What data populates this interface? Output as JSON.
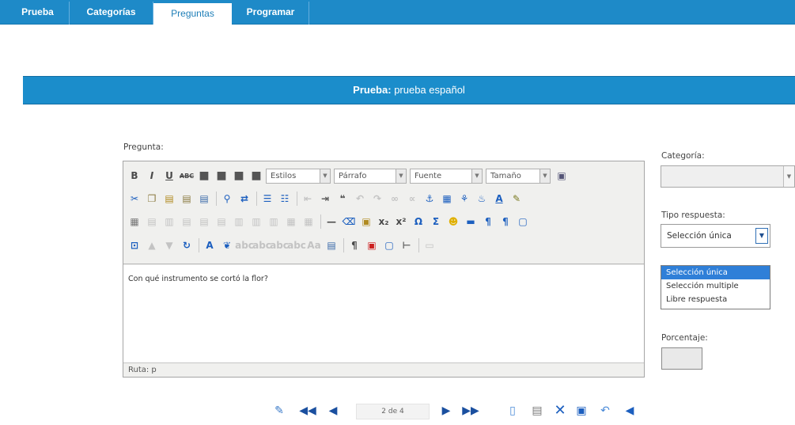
{
  "tabs": [
    {
      "label": "Prueba",
      "active": false
    },
    {
      "label": "Categorías",
      "active": false
    },
    {
      "label": "Preguntas",
      "active": true
    },
    {
      "label": "Programar",
      "active": false
    }
  ],
  "banner": {
    "prefix": "Prueba:",
    "name": "prueba español"
  },
  "form": {
    "question_label": "Pregunta:",
    "category_label": "Categoría:",
    "category_value": "",
    "answer_type_label": "Tipo respuesta:",
    "answer_type_value": "Selección única",
    "answer_type_options": [
      "Selección única",
      "Selección multiple",
      "Libre respuesta"
    ],
    "percentage_label": "Porcentaje:",
    "percentage_value": ""
  },
  "editor": {
    "styles_select": "Estilos",
    "format_select": "Párrafo",
    "font_select": "Fuente",
    "size_select": "Tamaño",
    "content": "Con qué instrumento se cortó la flor?",
    "status_path": "Ruta: p"
  },
  "pager": {
    "text": "2 de 4"
  },
  "colors": {
    "accent": "#1b8dcb",
    "highlight": "#2f7fd8"
  }
}
